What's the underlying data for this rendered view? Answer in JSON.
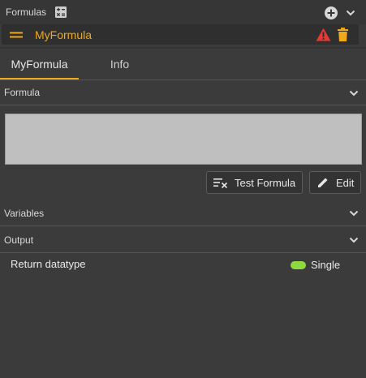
{
  "header": {
    "title": "Formulas",
    "calculator_icon": "calculator-icon",
    "add_icon": "plus-circle-icon",
    "collapse_icon": "chevron-down-icon"
  },
  "formula_item": {
    "name": "MyFormula",
    "warning_icon": "warning-triangle-icon",
    "delete_icon": "trash-icon",
    "handle_icon": "drag-handle-icon"
  },
  "colors": {
    "accent": "#f0a91a",
    "warning": "#e53935",
    "status_green": "#8ed93f"
  },
  "tabs": [
    {
      "label": "MyFormula"
    },
    {
      "label": "Info"
    }
  ],
  "sections": {
    "formula": "Formula",
    "variables": "Variables",
    "output": "Output"
  },
  "buttons": {
    "test_formula": "Test Formula",
    "edit": "Edit"
  },
  "output": {
    "label": "Return datatype",
    "value": "Single"
  }
}
